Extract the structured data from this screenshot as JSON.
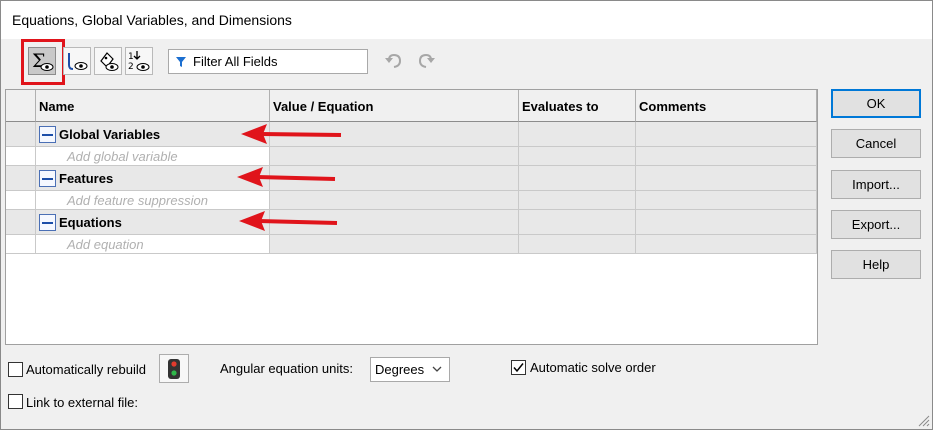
{
  "window": {
    "title": "Equations, Global Variables, and Dimensions"
  },
  "toolbar": {
    "buttons": [
      {
        "icon": "sigma-eye-icon",
        "tooltip": "Equation view",
        "active": true
      },
      {
        "icon": "sketch-eye-icon",
        "tooltip": "Sketch equation view",
        "active": false
      },
      {
        "icon": "dimension-eye-icon",
        "tooltip": "Dimension view",
        "active": false
      },
      {
        "icon": "ordered-eye-icon",
        "tooltip": "Ordered view",
        "active": false
      }
    ],
    "filter_placeholder": "Filter All Fields",
    "undo_icon": "undo-icon",
    "redo_icon": "redo-icon"
  },
  "table": {
    "columns": [
      "Name",
      "Value / Equation",
      "Evaluates to",
      "Comments"
    ],
    "sections": [
      {
        "label": "Global Variables",
        "add_placeholder": "Add global variable"
      },
      {
        "label": "Features",
        "add_placeholder": "Add feature suppression"
      },
      {
        "label": "Equations",
        "add_placeholder": "Add equation"
      }
    ]
  },
  "buttons": {
    "ok": "OK",
    "cancel": "Cancel",
    "import": "Import...",
    "export": "Export...",
    "help": "Help"
  },
  "bottom": {
    "auto_rebuild_label": "Automatically rebuild",
    "auto_rebuild_checked": false,
    "angular_units_label": "Angular equation units:",
    "angular_units_value": "Degrees",
    "auto_solve_label": "Automatic solve order",
    "auto_solve_checked": true,
    "link_external_label": "Link to external file:",
    "link_external_checked": false
  },
  "colors": {
    "annotation_red": "#e0141b",
    "accent_blue": "#0078d7"
  }
}
